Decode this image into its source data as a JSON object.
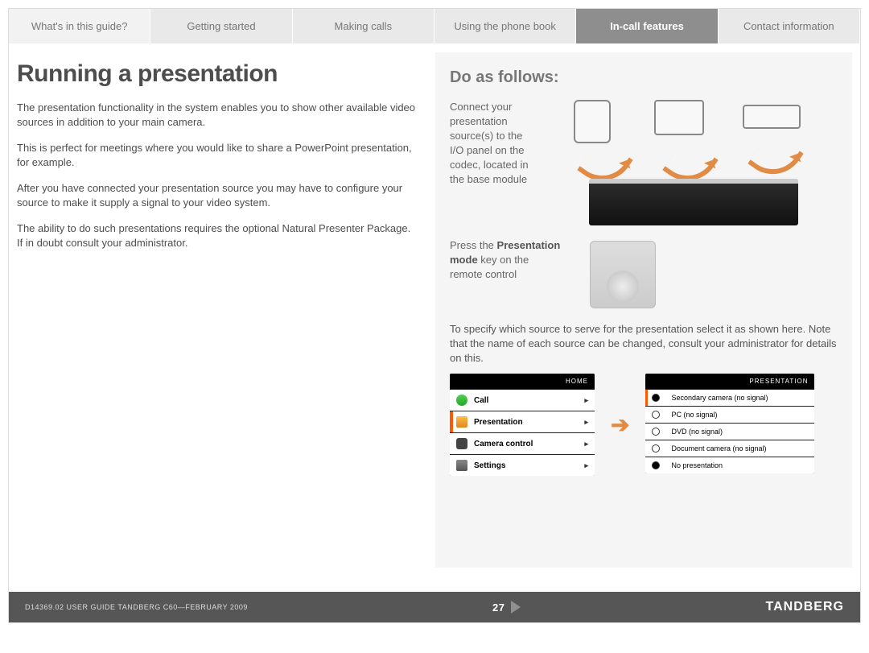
{
  "tabs": [
    "What's in this guide?",
    "Getting started",
    "Making calls",
    "Using the phone book",
    "In-call features",
    "Contact information"
  ],
  "activeTab": 4,
  "heading": "Running a presentation",
  "paras": [
    "The presentation functionality in the system enables you to show other available video sources in addition to your main camera.",
    "This is perfect for meetings where you would like to share a PowerPoint presentation, for example.",
    "After you have connected your presentation source you may have to configure your source to make it supply a signal to your video system.",
    "The ability to do such presentations requires the optional Natural Presenter Package. If in doubt consult your administrator."
  ],
  "doAs": "Do as follows:",
  "step1": "Connect your presentation source(s) to the I/O panel on the codec, located in the base module",
  "step2_pre": "Press the ",
  "step2_bold": "Presentation mode",
  "step2_post": " key on the remote control",
  "note": "To specify which source to serve for the presentation select it as shown here. Note that the name of each source can be changed, consult your administrator for details on this.",
  "homeMenu": {
    "title": "HOME",
    "items": [
      "Call",
      "Presentation",
      "Camera control",
      "Settings"
    ],
    "selected": 1
  },
  "presMenu": {
    "title": "PRESENTATION",
    "items": [
      "Secondary camera (no signal)",
      "PC (no signal)",
      "DVD (no signal)",
      "Document camera (no signal)",
      "No presentation"
    ],
    "selected": 0
  },
  "footer": {
    "doc": "D14369.02 USER GUIDE TANDBERG C60—FEBRUARY 2009",
    "page": "27",
    "brand": "TANDBERG"
  }
}
